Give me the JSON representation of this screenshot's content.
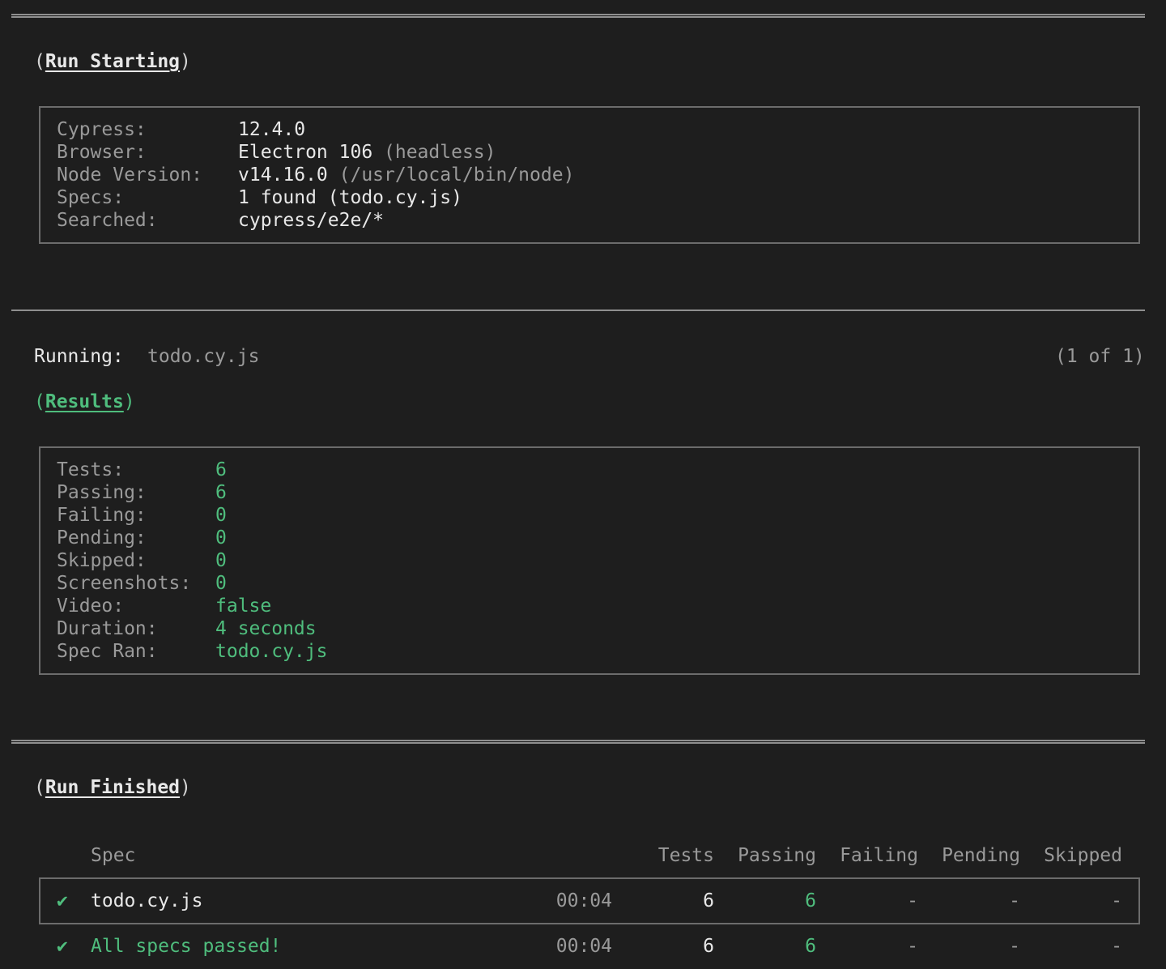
{
  "run_starting": {
    "title": "Run Starting",
    "rows": [
      {
        "label": "Cypress:",
        "value": "12.4.0",
        "note": ""
      },
      {
        "label": "Browser:",
        "value": "Electron 106",
        "note": " (headless)"
      },
      {
        "label": "Node Version:",
        "value": "v14.16.0",
        "note": " (/usr/local/bin/node)"
      },
      {
        "label": "Specs:",
        "value": "1 found (todo.cy.js)",
        "note": ""
      },
      {
        "label": "Searched:",
        "value": "cypress/e2e/*",
        "note": ""
      }
    ]
  },
  "running": {
    "label": "Running:",
    "spec": "todo.cy.js",
    "progress": "(1 of 1)"
  },
  "results": {
    "title": "Results",
    "rows": [
      {
        "label": "Tests:",
        "value": "6"
      },
      {
        "label": "Passing:",
        "value": "6"
      },
      {
        "label": "Failing:",
        "value": "0"
      },
      {
        "label": "Pending:",
        "value": "0"
      },
      {
        "label": "Skipped:",
        "value": "0"
      },
      {
        "label": "Screenshots:",
        "value": "0"
      },
      {
        "label": "Video:",
        "value": "false"
      },
      {
        "label": "Duration:",
        "value": "4 seconds"
      },
      {
        "label": "Spec Ran:",
        "value": "todo.cy.js"
      }
    ]
  },
  "run_finished": {
    "title": "Run Finished",
    "headers": {
      "spec": "Spec",
      "tests": "Tests",
      "passing": "Passing",
      "failing": "Failing",
      "pending": "Pending",
      "skipped": "Skipped"
    },
    "spec_row": {
      "icon": "✔",
      "spec": "todo.cy.js",
      "time": "00:04",
      "tests": "6",
      "passing": "6",
      "failing": "-",
      "pending": "-",
      "skipped": "-"
    },
    "total_row": {
      "icon": "✔",
      "spec": "All specs passed!",
      "time": "00:04",
      "tests": "6",
      "passing": "6",
      "failing": "-",
      "pending": "-",
      "skipped": "-"
    }
  },
  "colors": {
    "background": "#1e1e1e",
    "green": "#4fbd7d",
    "gray": "#9a9a9a",
    "white": "#e8e8e8"
  },
  "icons": {
    "pass": "checkmark-icon"
  }
}
